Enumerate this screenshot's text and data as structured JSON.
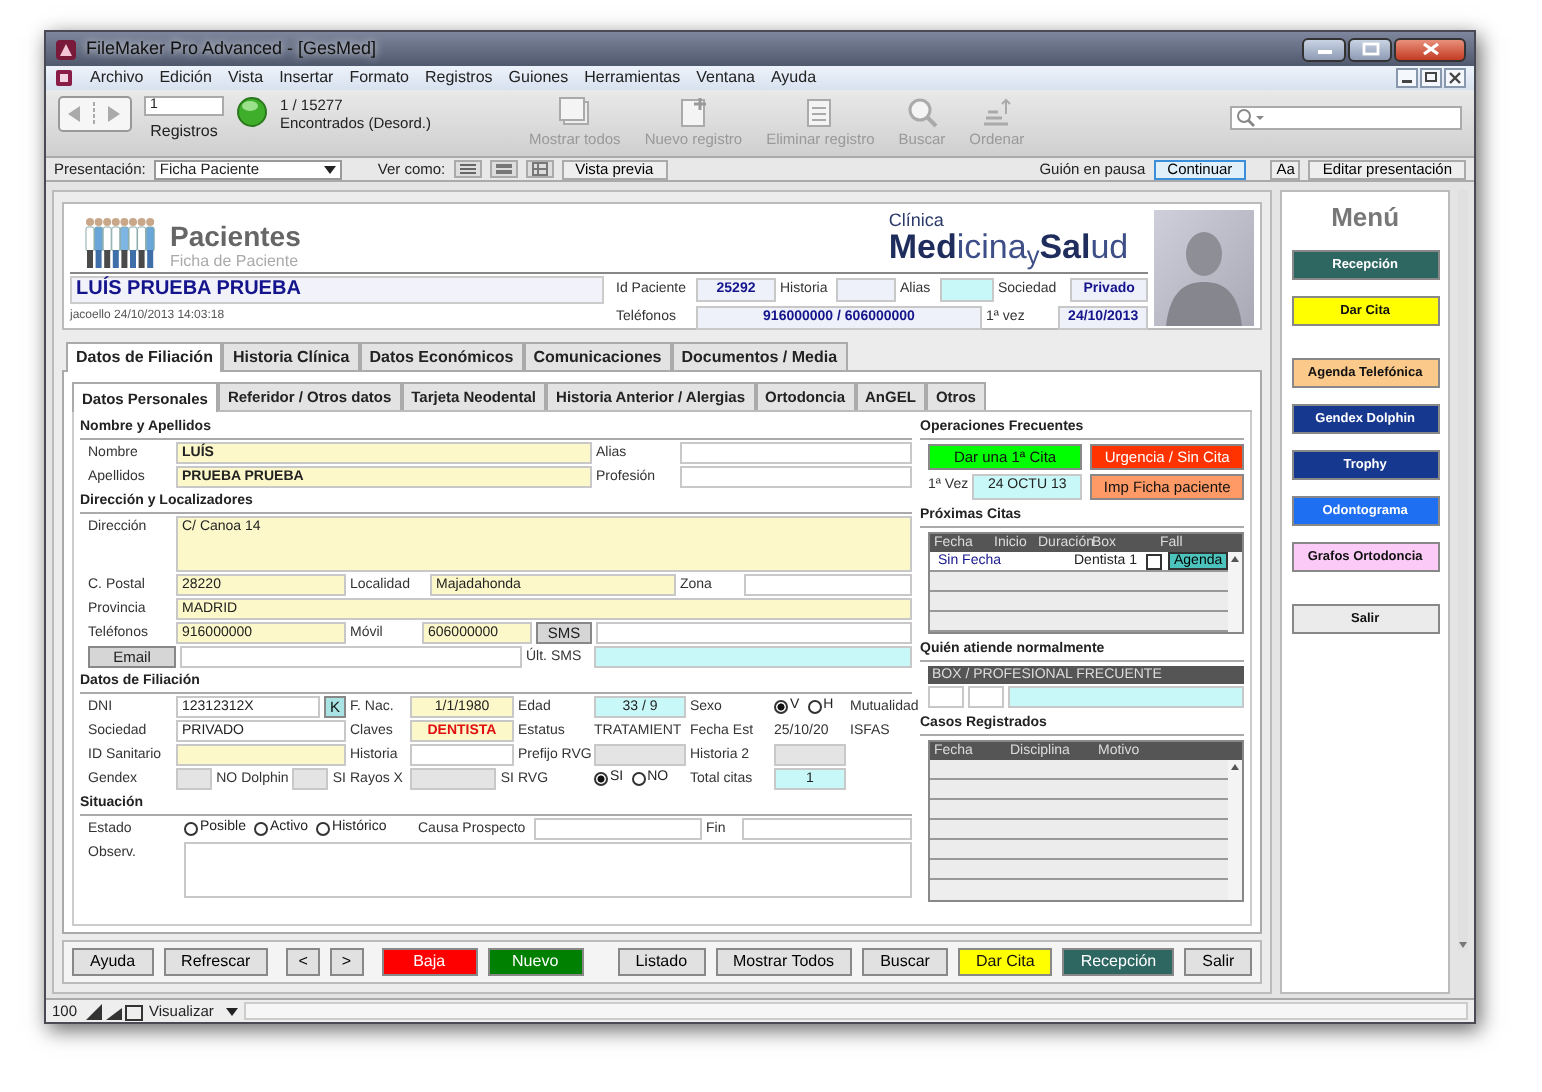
{
  "window": {
    "title": "FileMaker Pro Advanced - [GesMed]"
  },
  "menu": [
    "Archivo",
    "Edición",
    "Vista",
    "Insertar",
    "Formato",
    "Registros",
    "Guiones",
    "Herramientas",
    "Ventana",
    "Ayuda"
  ],
  "toolbar": {
    "record": "1",
    "records_label": "Registros",
    "count": "1 / 15277",
    "found": "Encontrados (Desord.)",
    "buttons": [
      {
        "label": "Mostrar todos",
        "kind": "all",
        "disabled": true
      },
      {
        "label": "Nuevo registro",
        "kind": "new",
        "disabled": true
      },
      {
        "label": "Eliminar registro",
        "kind": "delete",
        "disabled": true
      },
      {
        "label": "Buscar",
        "kind": "find",
        "disabled": true
      },
      {
        "label": "Ordenar",
        "kind": "sort",
        "disabled": true
      }
    ]
  },
  "layout_bar": {
    "label": "Presentación:",
    "layout": "Ficha Paciente",
    "view_label": "Ver como:",
    "preview": "Vista previa",
    "paused": "Guión en pausa",
    "continue": "Continuar",
    "text_button": "Aa",
    "edit": "Editar presentación"
  },
  "header": {
    "title": "Pacientes",
    "subtitle": "Ficha de Paciente",
    "brand_top": "Clínica",
    "brand": "**Med**icina$_{y}$**Sal**ud",
    "patient": "LUÍS PRUEBA PRUEBA",
    "stamp": "jacoello 24/10/2013 14:03:18",
    "info": [
      [
        {
          "kind": "label",
          "text": "Id Paciente"
        },
        {
          "kind": "field",
          "value": "25292",
          "color": "#eef0fa"
        },
        {
          "kind": "label",
          "text": "Historia"
        },
        {
          "kind": "field",
          "color": "#eef0fa"
        },
        {
          "kind": "label",
          "text": "Alias"
        },
        {
          "kind": "field",
          "color": "#c9f8f8"
        },
        {
          "kind": "label",
          "text": "Sociedad"
        },
        {
          "kind": "field",
          "value": "Privado",
          "color": "#eef0fa"
        }
      ],
      [
        {
          "kind": "label",
          "text": "Teléfonos"
        },
        {
          "kind": "field",
          "value": "916000000 / 606000000",
          "color": "#eef0fa"
        },
        {
          "kind": "label",
          "text": "1ª vez"
        },
        {
          "kind": "field",
          "value": "24/10/2013",
          "color": "#eef0fa"
        }
      ]
    ]
  },
  "tabs": [
    {
      "label": "Datos de Filiación",
      "selected": true
    },
    {
      "label": "Historia Clínica",
      "selected": false
    },
    {
      "label": "Datos Económicos",
      "selected": false
    },
    {
      "label": "Comunicaciones",
      "selected": false
    },
    {
      "label": "Documentos / Media",
      "selected": false
    }
  ],
  "subtabs": [
    {
      "label": "Datos Personales",
      "selected": true
    },
    {
      "label": "Referidor / Otros datos",
      "selected": false
    },
    {
      "label": "Tarjeta Neodental",
      "selected": false
    },
    {
      "label": "Historia Anterior / Alergias",
      "selected": false
    },
    {
      "label": "Ortodoncia",
      "selected": false
    },
    {
      "label": "AnGEL",
      "selected": false
    },
    {
      "label": "Otros",
      "selected": false
    }
  ],
  "form": [
    {
      "title": "Nombre y Apellidos",
      "rows": [
        [
          {
            "kind": "label",
            "text": "Nombre"
          },
          {
            "kind": "field",
            "value": "LUÍS",
            "color": "#fcf8c9"
          },
          {
            "kind": "label",
            "text": "Alias"
          },
          {
            "kind": "field",
            "color": "#ffffff"
          }
        ],
        [
          {
            "kind": "label",
            "text": "Apellidos"
          },
          {
            "kind": "field",
            "value": "PRUEBA PRUEBA",
            "color": "#fcf8c9"
          },
          {
            "kind": "label",
            "text": "Profesión"
          },
          {
            "kind": "field",
            "color": "#ffffff"
          }
        ]
      ]
    },
    {
      "title": "Dirección y Localizadores",
      "rows": [
        [
          {
            "kind": "label",
            "text": "Dirección"
          },
          {
            "kind": "field",
            "value": "C/ Canoa 14",
            "color": "#fcf8c9"
          }
        ],
        [
          {
            "kind": "label",
            "text": "C. Postal"
          },
          {
            "kind": "field",
            "value": "28220",
            "color": "#fcf8c9"
          },
          {
            "kind": "label",
            "text": "Localidad"
          },
          {
            "kind": "field",
            "value": "Majadahonda",
            "color": "#fcf8c9"
          },
          {
            "kind": "label",
            "text": "Zona"
          },
          {
            "kind": "field",
            "color": "#ffffff"
          }
        ],
        [
          {
            "kind": "label",
            "text": "Provincia"
          },
          {
            "kind": "field",
            "value": "MADRID",
            "color": "#fcf8c9"
          }
        ],
        [
          {
            "kind": "label",
            "text": "Teléfonos"
          },
          {
            "kind": "field",
            "value": "916000000",
            "color": "#fcf8c9"
          },
          {
            "kind": "label",
            "text": "Móvil"
          },
          {
            "kind": "field",
            "value": "606000000",
            "color": "#fcf8c9"
          },
          {
            "kind": "button",
            "label": "SMS"
          },
          {
            "kind": "field",
            "color": "#ffffff"
          }
        ],
        [
          {
            "kind": "button",
            "label": "Email"
          },
          {
            "kind": "field",
            "color": "#ffffff"
          },
          {
            "kind": "label",
            "text": "Últ. SMS"
          },
          {
            "kind": "field",
            "color": "#c9f8f8"
          }
        ]
      ]
    },
    {
      "title": "Datos de Filiación",
      "rows": [
        [
          {
            "kind": "label",
            "text": "DNI"
          },
          {
            "kind": "group",
            "items": [
              {
                "kind": "field",
                "value": "12312312X",
                "color": "#ffffff"
              },
              {
                "kind": "button",
                "label": "K",
                "color": "#a9e3e3"
              }
            ]
          },
          {
            "kind": "label",
            "text": "F. Nac."
          },
          {
            "kind": "field",
            "value": "1/1/1980",
            "color": "#fcf8c9"
          },
          {
            "kind": "label",
            "text": "Edad"
          },
          {
            "kind": "field",
            "value": "33 / 9",
            "color": "#c9f8f8"
          },
          {
            "kind": "label",
            "text": "Sexo"
          },
          {
            "kind": "radios",
            "options": [
              {
                "label": "V",
                "selected": true
              },
              {
                "label": "H",
                "selected": false
              }
            ]
          },
          {
            "kind": "label",
            "text": "Mutualidad"
          }
        ],
        [
          {
            "kind": "label",
            "text": "Sociedad"
          },
          {
            "kind": "field",
            "value": "PRIVADO",
            "color": "#ffffff"
          },
          {
            "kind": "label",
            "text": "Claves"
          },
          {
            "kind": "field",
            "value": "DENTISTA",
            "color": "#fcf8c9"
          },
          {
            "kind": "label",
            "text": "Estatus"
          },
          {
            "kind": "value",
            "text": "TRATAMIENT"
          },
          {
            "kind": "label",
            "text": "Fecha Est"
          },
          {
            "kind": "value",
            "text": "25/10/20"
          },
          {
            "kind": "value",
            "text": "ISFAS"
          }
        ],
        [
          {
            "kind": "label",
            "text": "ID Sanitario"
          },
          {
            "kind": "field",
            "color": "#fcf8c9"
          },
          {
            "kind": "label",
            "text": "Historia"
          },
          {
            "kind": "field",
            "color": "#ffffff"
          },
          {
            "kind": "label",
            "text": "Prefijo RVG"
          },
          {
            "kind": "field",
            "color": "#e4e4e4"
          },
          {
            "kind": "label",
            "text": "Historia 2"
          },
          {
            "kind": "field",
            "color": "#e4e4e4"
          }
        ],
        [
          {
            "kind": "label",
            "text": "Gendex"
          },
          {
            "kind": "group",
            "items": [
              {
                "kind": "field",
                "color": "#e4e4e4"
              },
              {
                "kind": "value",
                "text": "NO"
              },
              {
                "kind": "label",
                "text": "Dolphin"
              },
              {
                "kind": "field",
                "color": "#e4e4e4"
              },
              {
                "kind": "value",
                "text": "SI"
              }
            ]
          },
          {
            "kind": "label",
            "text": "Rayos X"
          },
          {
            "kind": "group",
            "items": [
              {
                "kind": "field",
                "color": "#e4e4e4"
              },
              {
                "kind": "value",
                "text": "SI"
              }
            ]
          },
          {
            "kind": "label",
            "text": "RVG"
          },
          {
            "kind": "radios",
            "options": [
              {
                "label": "SI",
                "selected": true
              },
              {
                "label": "NO",
                "selected": false
              }
            ]
          },
          {
            "kind": "label",
            "text": "Total citas"
          },
          {
            "kind": "field",
            "value": "1",
            "color": "#c9f8f8"
          }
        ]
      ]
    },
    {
      "title": "Situación",
      "rows": [
        [
          {
            "kind": "label",
            "text": "Estado"
          },
          {
            "kind": "radios",
            "options": [
              {
                "label": "Posible",
                "selected": false
              },
              {
                "label": "Activo",
                "selected": false
              },
              {
                "label": "Histórico",
                "selected": false
              }
            ]
          },
          {
            "kind": "label",
            "text": "Causa Prospecto"
          },
          {
            "kind": "field",
            "color": "#ffffff"
          },
          {
            "kind": "label",
            "text": "Fin"
          },
          {
            "kind": "field",
            "color": "#ffffff"
          }
        ],
        [
          {
            "kind": "label",
            "text": "Observ."
          },
          {
            "kind": "field",
            "color": "#ffffff"
          }
        ]
      ]
    }
  ],
  "side": {
    "operations": {
      "title": "Operaciones Frecuentes",
      "rows": [
        [
          {
            "kind": "button",
            "label": "Dar una 1ª Cita",
            "color": "#00ff00"
          },
          {
            "kind": "button",
            "label": "Urgencia / Sin Cita",
            "color": "#ff3300"
          }
        ],
        [
          {
            "kind": "group",
            "items": [
              {
                "kind": "label",
                "text": "1ª Vez"
              },
              {
                "kind": "field",
                "value": "24 OCTU 13",
                "color": "#c9f8f8"
              }
            ]
          },
          {
            "kind": "button",
            "label": "Imp Ficha paciente",
            "color": "#ff9966"
          }
        ]
      ]
    },
    "appointments": {
      "title": "Próximas Citas",
      "columns": [
        "Fecha",
        "Inicio",
        "Duración",
        "Box",
        "Fall"
      ],
      "rows": [
        {
          "date": "Sin Fecha",
          "box": "Dentista 1",
          "fail": false,
          "action": "Agenda"
        }
      ]
    },
    "attending": {
      "title": "Quién atiende normalmente",
      "header": "BOX / PROFESIONAL FRECUENTE"
    },
    "cases": {
      "title": "Casos Registrados",
      "columns": [
        "Fecha",
        "Disciplina",
        "Motivo"
      ]
    }
  },
  "actions": {
    "left": [
      {
        "label": "Ayuda"
      },
      {
        "label": "Refrescar"
      },
      {
        "label": "<"
      },
      {
        "label": ">"
      },
      {
        "label": "Baja",
        "color": "#ff0000"
      },
      {
        "label": "Nuevo",
        "color": "#008000"
      }
    ],
    "right": [
      {
        "label": "Listado"
      },
      {
        "label": "Mostrar Todos"
      },
      {
        "label": "Buscar"
      },
      {
        "label": "Dar Cita",
        "color": "#ffff00"
      },
      {
        "label": "Recepción",
        "color": "#2e6662"
      },
      {
        "label": "Salir"
      }
    ]
  },
  "menu_panel": {
    "title": "Menú",
    "buttons": [
      {
        "label": "Recepción",
        "color": "#2e6662"
      },
      {
        "label": "Dar Cita",
        "color": "#ffff00"
      },
      {
        "label": "Agenda Telefónica",
        "color": "#fbc98a"
      },
      {
        "label": "Gendex Dolphin",
        "color": "#17388f"
      },
      {
        "label": "Trophy",
        "color": "#17388f"
      },
      {
        "label": "Odontograma",
        "color": "#1f6ff2"
      },
      {
        "label": "Grafos Ortodoncia",
        "color": "#fbcaf6"
      },
      {
        "label": "Salir",
        "color": "#ebebeb"
      }
    ]
  },
  "status_bar": {
    "zoom": "100",
    "mode": "Visualizar"
  }
}
